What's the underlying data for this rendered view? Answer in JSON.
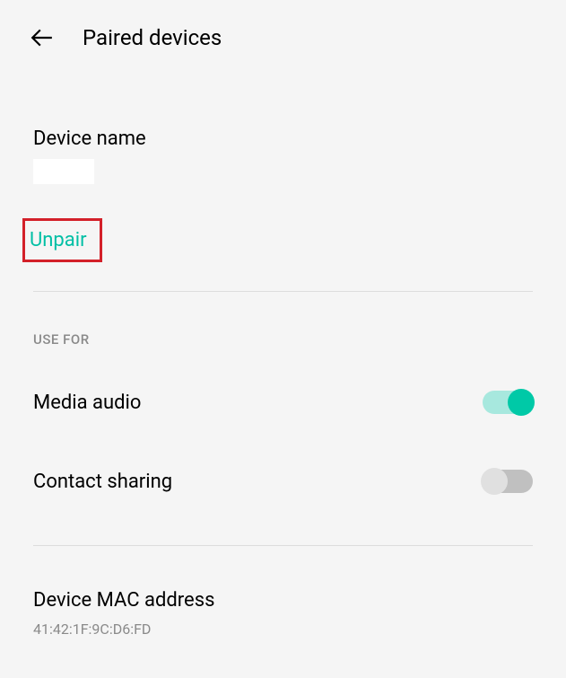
{
  "header": {
    "title": "Paired devices"
  },
  "device_name": {
    "label": "Device name",
    "value": ""
  },
  "unpair": {
    "label": "Unpair"
  },
  "use_for": {
    "header": "USE FOR",
    "media_audio": {
      "label": "Media audio",
      "enabled": true
    },
    "contact_sharing": {
      "label": "Contact sharing",
      "enabled": false
    }
  },
  "mac": {
    "label": "Device MAC address",
    "value": "41:42:1F:9C:D6:FD"
  },
  "colors": {
    "accent": "#00bfa5",
    "highlight_border": "#d32029"
  }
}
